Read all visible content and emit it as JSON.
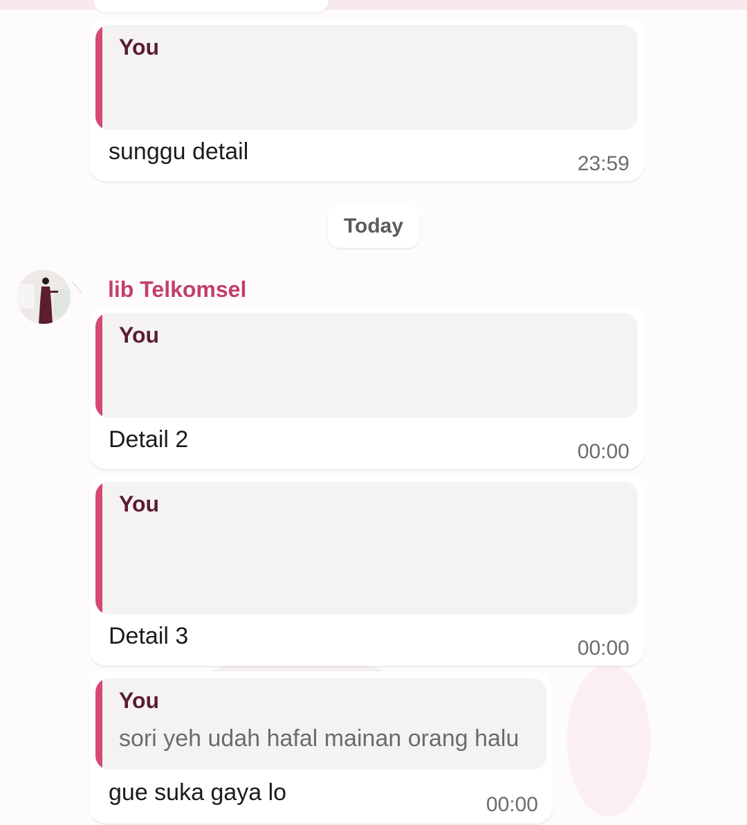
{
  "date_separator": "Today",
  "sender": {
    "name": "lib Telkomsel",
    "avatar_icon": "profile-photo"
  },
  "colors": {
    "accent": "#d44a75",
    "sender_name": "#c23f6a",
    "quote_author": "#5a1c36",
    "quote_bg": "#f5f3f2"
  },
  "messages": [
    {
      "quote_author": "You",
      "quote_text": "",
      "text": "sunggu detail",
      "time": "23:59"
    },
    {
      "quote_author": "You",
      "quote_text": "",
      "text": "Detail 2",
      "time": "00:00"
    },
    {
      "quote_author": "You",
      "quote_text": "",
      "text": "Detail 3",
      "time": "00:00"
    },
    {
      "quote_author": "You",
      "quote_text": "sori yeh udah hafal mainan orang halu",
      "text": "gue suka gaya lo",
      "time": "00:00"
    }
  ]
}
